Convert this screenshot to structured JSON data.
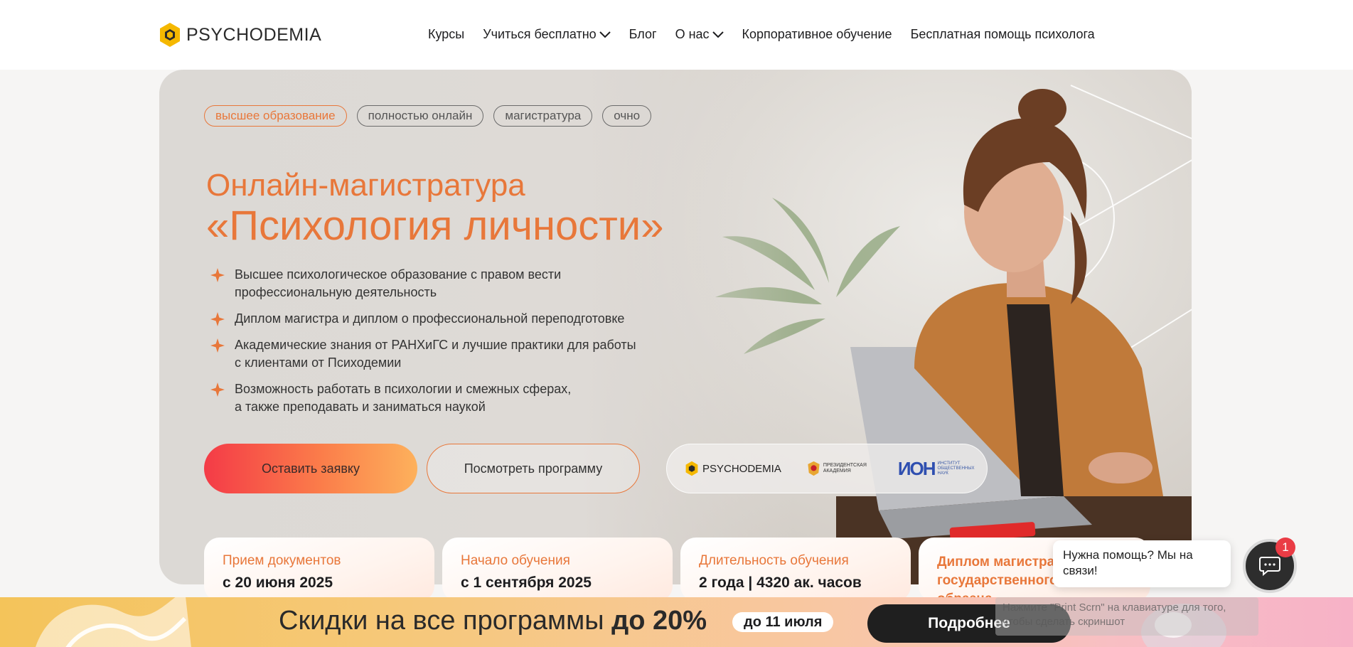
{
  "header": {
    "logo_text": "PSYCHODEMIA",
    "nav": [
      {
        "label": "Курсы",
        "has_dropdown": false
      },
      {
        "label": "Учиться бесплатно",
        "has_dropdown": true
      },
      {
        "label": "Блог",
        "has_dropdown": false
      },
      {
        "label": "О нас",
        "has_dropdown": true
      },
      {
        "label": "Корпоративное обучение",
        "has_dropdown": false
      },
      {
        "label": "Бесплатная помощь психолога",
        "has_dropdown": false
      }
    ]
  },
  "hero": {
    "tags": [
      "высшее образование",
      "полностью онлайн",
      "магистратура",
      "очно"
    ],
    "title_line1": "Онлайн-магистратура",
    "title_line2": "«Психология личности»",
    "features": [
      {
        "line1": "Высшее психологическое образование с правом вести",
        "line2": "профессиональную деятельность"
      },
      {
        "line1": "Диплом магистра и диплом о профессиональной переподготовке",
        "line2": ""
      },
      {
        "line1": "Академические знания от РАНХиГС и лучшие практики для работы",
        "line2": "с клиентами от Психодемии"
      },
      {
        "line1": "Возможность работать в психологии и смежных сферах,",
        "line2": "а также преподавать и заниматься наукой"
      }
    ],
    "primary_button": "Оставить заявку",
    "secondary_button": "Посмотреть программу",
    "partners": {
      "psychodemia": "PSYCHODEMIA",
      "academy": "ПРЕЗИДЕНТСКАЯ АКАДЕМИЯ",
      "ion_mark": "ИОН",
      "ion_text": "ИНСТИТУТ ОБЩЕСТВЕННЫХ НАУК"
    }
  },
  "cards": [
    {
      "label": "Прием документов",
      "value": "с 20 июня 2025"
    },
    {
      "label": "Начало обучения",
      "value": "с 1 сентября 2025"
    },
    {
      "label": "Длительность обучения",
      "value": "2 года | 4320 ак. часов"
    },
    {
      "label": "Диплом магистра государственного образца",
      "value": ""
    }
  ],
  "promo": {
    "text_plain": "Скидки на все программы ",
    "text_bold": "до 20%",
    "pill": "до 11 июля",
    "button": "Подробнее"
  },
  "chat": {
    "bubble": "Нужна помощь? Мы на связи!",
    "badge": "1"
  },
  "toast": {
    "text": "Нажмите \"Print Scrn\" на клавиатуре для того, чтобы сделать скриншот"
  },
  "colors": {
    "accent": "#e8773a",
    "badge": "#ea3c45",
    "dark_button": "#1f1f1f"
  }
}
